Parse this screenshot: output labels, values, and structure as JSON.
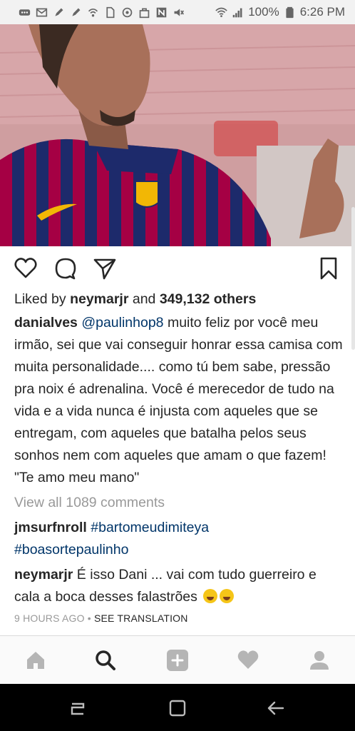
{
  "status_bar": {
    "battery": "100%",
    "time": "6:26 PM",
    "left_icons": [
      "more-icon",
      "mail-icon",
      "pen-icon",
      "pen-icon",
      "wifi-call-icon",
      "sim-icon",
      "sync-icon",
      "bag-icon",
      "nfc-icon",
      "mute-icon",
      "wifi-icon",
      "signal-icon",
      "battery-icon"
    ]
  },
  "post": {
    "image_alt": "Soccer player in striped club jersey",
    "likes": {
      "prefix": "Liked by ",
      "user": "neymarjr",
      "and": " and ",
      "count": "349,132 others"
    },
    "caption": {
      "user": "danialves",
      "mention": "@paulinhop8",
      "text": " muito feliz por você meu irmão, sei que vai conseguir honrar essa camisa com muita personalidade.... como tú bem sabe, pressão pra noix é adrenalina.  Você é merecedor de tudo na vida e a vida nunca é injusta com aqueles que se entregam, com aqueles que batalha pelos seus sonhos nem com aqueles que amam o que fazem!",
      "quote": "\"Te amo meu mano\""
    },
    "view_all": "View all 1089 comments",
    "comments": [
      {
        "user": "jmsurfnroll",
        "tag1": "#bartomeudimiteya",
        "tag2": "#boasortepaulinho"
      },
      {
        "user": "neymarjr",
        "text": " É isso Dani ... vai com tudo guerreiro e cala a boca desses falastrões"
      }
    ],
    "time_ago": "9 HOURS AGO",
    "separator": " • ",
    "see_translation": "SEE TRANSLATION"
  },
  "colors": {
    "link": "#003569",
    "muted": "#999999",
    "text": "#262626",
    "jersey_red": "#a50044",
    "jersey_blue": "#1d2a6b"
  }
}
